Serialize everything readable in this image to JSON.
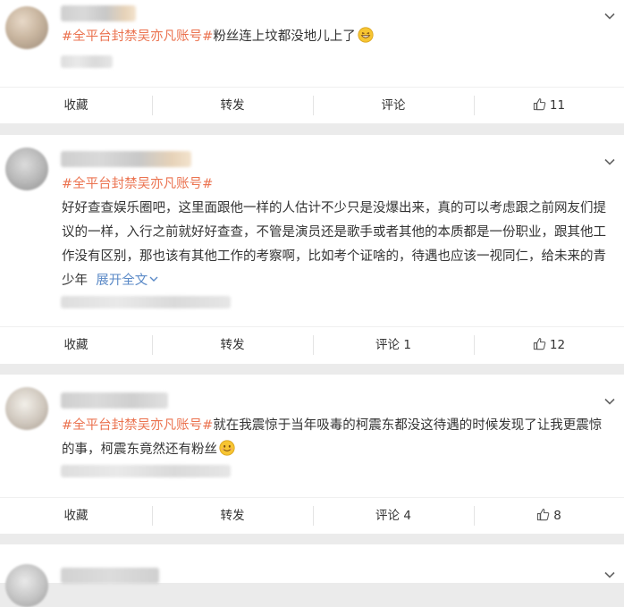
{
  "posts": [
    {
      "tag": "#全平台封禁吴亦凡账号#",
      "text": "粉丝连上坟都没地儿上了",
      "emoji": "grin-emoji",
      "actions": {
        "collect": "收藏",
        "repost": "转发",
        "comment": "评论",
        "likes": "11"
      }
    },
    {
      "tag": "#全平台封禁吴亦凡账号#",
      "line1": "好好查查娱乐圈吧，这里面跟他一样的人估计不少只是没爆出来，真的可以考虑跟之前网友们提",
      "line2": "议的一样，入行之前就好好查查，不管是演员还是歌手或者其他的本质都是一份职业，跟其他工",
      "line3": "作没有区别，那也该有其他工作的考察啊，比如考个证啥的，待遇也应该一视同仁，给未来的青",
      "line4_text": "少年",
      "expand": "展开全文",
      "actions": {
        "collect": "收藏",
        "repost": "转发",
        "comment": "评论 1",
        "likes": "12"
      }
    },
    {
      "tag": "#全平台封禁吴亦凡账号#",
      "line1": "就在我震惊于当年吸毒的柯震东都没这待遇的时候发现了让我更震惊",
      "line2": "的事，柯震东竟然还有粉丝",
      "emoji": "smile-emoji",
      "actions": {
        "collect": "收藏",
        "repost": "转发",
        "comment": "评论 4",
        "likes": "8"
      }
    }
  ],
  "colors": {
    "tag": "#eb7350",
    "link": "#5b8ac7",
    "background": "#ebebeb"
  }
}
